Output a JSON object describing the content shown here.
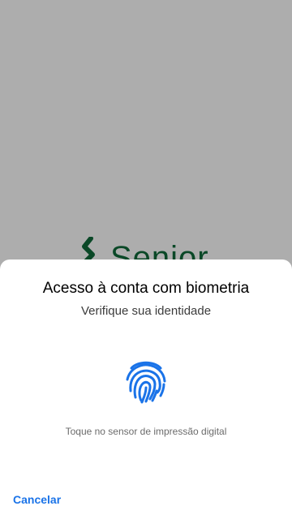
{
  "app": {
    "brand_text": "Senior",
    "brand_color": "#0f6a3a"
  },
  "dialog": {
    "title": "Acesso à conta com biometria",
    "subtitle": "Verifique sua identidade",
    "hint": "Toque no sensor de impressão digital",
    "icon": "fingerprint-icon",
    "accent_color": "#1a73e8",
    "cancel_label": "Cancelar"
  }
}
